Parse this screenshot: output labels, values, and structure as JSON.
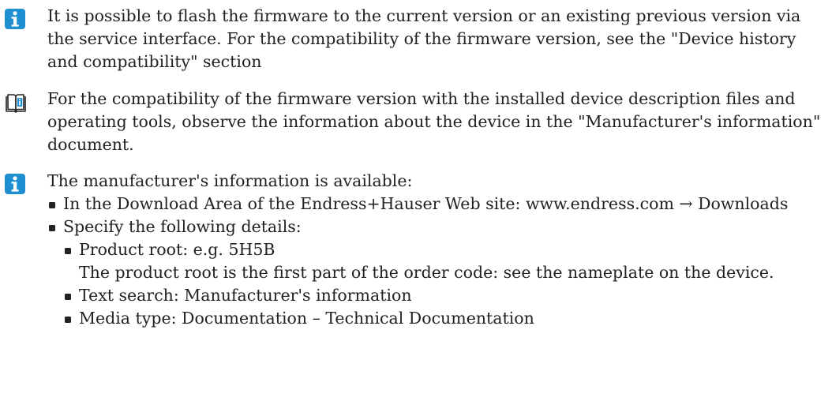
{
  "notes": [
    {
      "icon": "info-icon",
      "text": "It is possible to flash the firmware to the current version or an existing previous version via the service interface. For the compatibility of the firmware version, see the \"Device history and compatibility\" section"
    },
    {
      "icon": "book-icon",
      "text": "For the compatibility of the firmware version with the installed device description files and operating tools, observe the information about the device in the \"Manufacturer's information\" document."
    },
    {
      "icon": "info-icon",
      "intro": "The manufacturer's information is available:",
      "items": [
        "In the Download Area of the Endress+Hauser Web site: www.endress.com → Downloads",
        "Specify the following details:"
      ],
      "details": [
        {
          "label": "Product root: e.g. 5H5B",
          "note": "The product root is the first part of the order code: see the nameplate on the device."
        },
        {
          "label": "Text search: Manufacturer's information"
        },
        {
          "label": "Media type: Documentation – Technical Documentation"
        }
      ]
    }
  ],
  "colors": {
    "info_icon_bg": "#1e8fd0",
    "text": "#222222"
  }
}
